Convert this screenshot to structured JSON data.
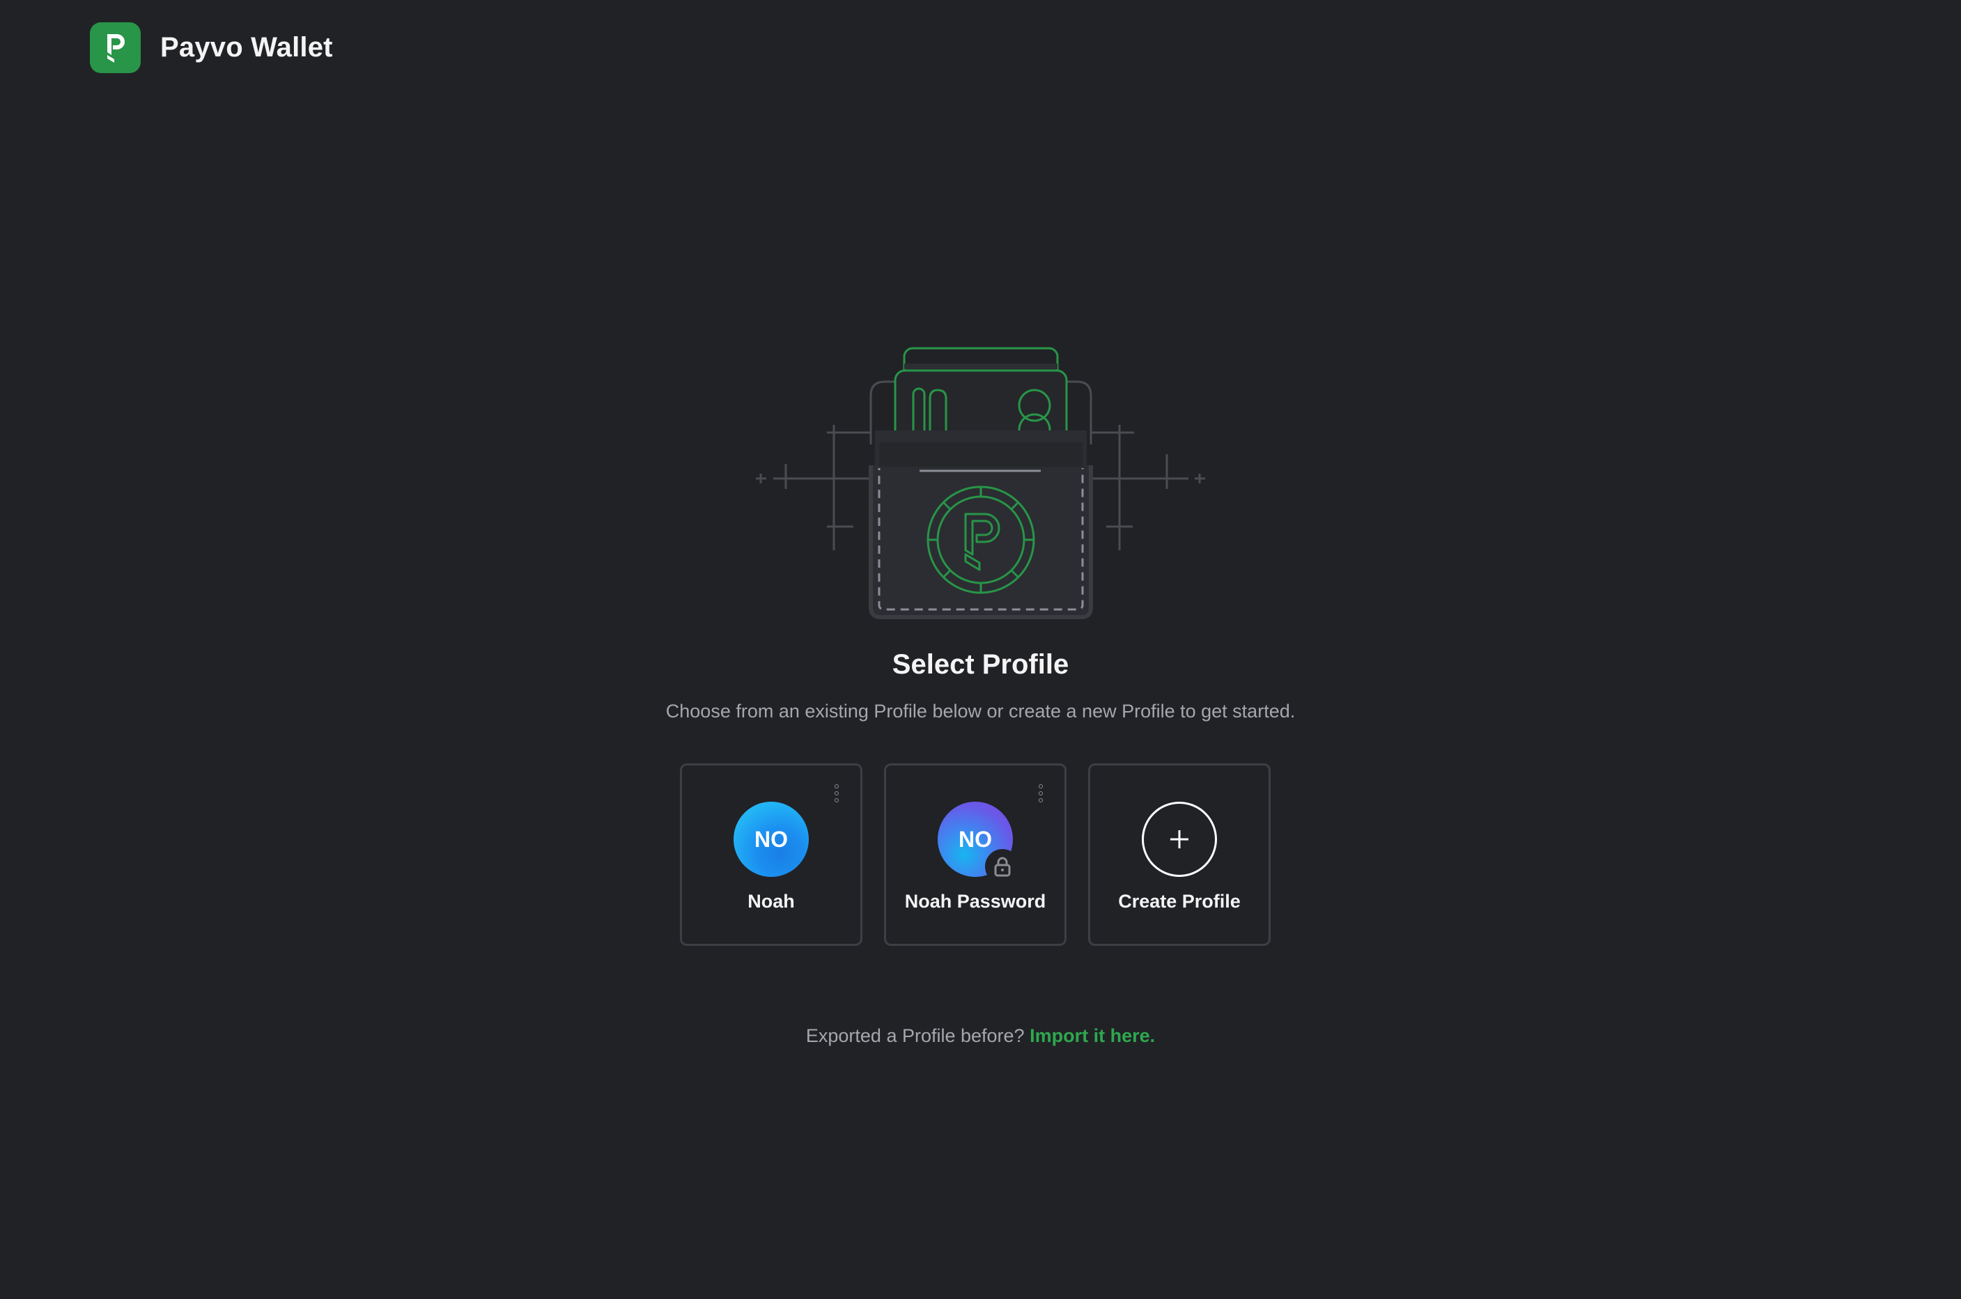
{
  "header": {
    "app_title": "Payvo Wallet",
    "logo_icon": "payvo-logo-icon"
  },
  "main": {
    "title": "Select Profile",
    "description": "Choose from an existing Profile below or create a new Profile to get started.",
    "profiles": [
      {
        "initials": "NO",
        "name": "Noah",
        "locked": false,
        "avatar_color": "#1b8ff0"
      },
      {
        "initials": "NO",
        "name": "Noah Password",
        "locked": true,
        "avatar_color": "#6a58e8"
      }
    ],
    "create_profile": {
      "label": "Create Profile",
      "icon": "plus-icon"
    },
    "import": {
      "prompt": "Exported a Profile before?",
      "link_label": "Import it here."
    }
  },
  "colors": {
    "background": "#212226",
    "accent": "#289548",
    "card_border": "#3d3f45",
    "muted_text": "#a5a7ad"
  }
}
